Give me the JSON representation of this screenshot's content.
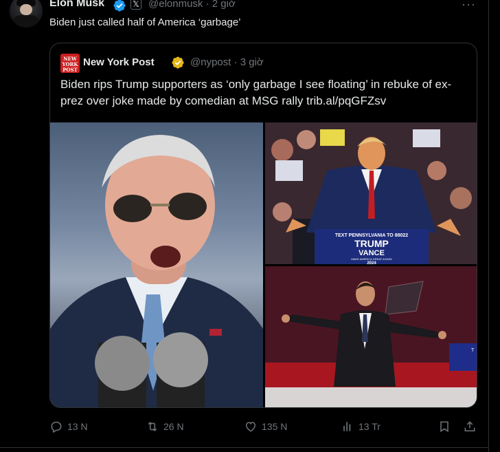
{
  "tweet": {
    "author_name": "Elon Musk",
    "handle_time": "@elonmusk · 2 giờ",
    "text": "Biden just called half of America ‘garbage’",
    "more": "···"
  },
  "quote": {
    "logo_text": "NEW YORK POST",
    "author_name": "New York Post",
    "handle_time": "@nypost · 3 giờ",
    "text": "Biden rips Trump supporters as ‘only garbage I see floating’ in rebuke of ex-prez over joke made by comedian at MSG rally trib.al/pqGFZsv",
    "podium_sign": {
      "line1": "TEXT PENNSYLVANIA TO 88022",
      "line2": "TRUMP",
      "line3": "VANCE",
      "line4": "MAKE AMERICA GREAT AGAIN!",
      "line5": "2024"
    }
  },
  "actions": {
    "reply": "13 N",
    "retweet": "26 N",
    "like": "135 N",
    "views": "13 Tr"
  },
  "colors": {
    "background": "#000000",
    "text": "#e7e9ea",
    "muted": "#71767b",
    "verified_blue": "#1d9bf0",
    "verified_gold": "#e2b719",
    "nypost_red": "#cc1f20"
  }
}
